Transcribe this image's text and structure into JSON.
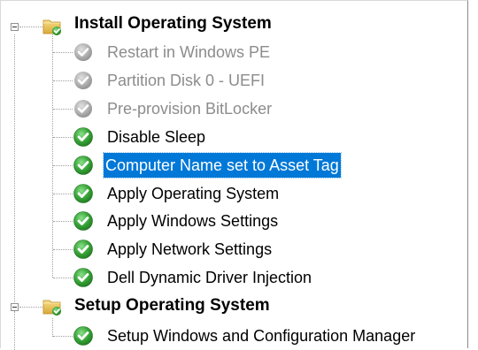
{
  "tree": {
    "groups": [
      {
        "label": "Install Operating System",
        "expanded": true,
        "icon": "folder-check-icon",
        "items": [
          {
            "label": "Restart in Windows PE",
            "state": "disabled",
            "icon": "gray-check-icon"
          },
          {
            "label": "Partition Disk 0 - UEFI",
            "state": "disabled",
            "icon": "gray-check-icon"
          },
          {
            "label": "Pre-provision BitLocker",
            "state": "disabled",
            "icon": "gray-check-icon"
          },
          {
            "label": "Disable Sleep",
            "state": "enabled",
            "icon": "green-check-icon"
          },
          {
            "label": "Computer Name set to Asset Tag",
            "state": "selected",
            "icon": "green-check-icon"
          },
          {
            "label": "Apply Operating System",
            "state": "enabled",
            "icon": "green-check-icon"
          },
          {
            "label": "Apply Windows Settings",
            "state": "enabled",
            "icon": "green-check-icon"
          },
          {
            "label": "Apply Network Settings",
            "state": "enabled",
            "icon": "green-check-icon"
          },
          {
            "label": "Dell Dynamic Driver Injection",
            "state": "enabled",
            "icon": "green-check-icon"
          }
        ]
      },
      {
        "label": "Setup Operating System",
        "expanded": true,
        "icon": "folder-check-icon",
        "items": [
          {
            "label": "Setup Windows and Configuration Manager",
            "state": "enabled",
            "icon": "green-check-icon"
          }
        ]
      }
    ]
  },
  "colors": {
    "selection": "#0078d7",
    "check_green": "#3aa63a",
    "check_gray": "#a6a6a6",
    "folder": "#e8c35a",
    "disabled_text": "#8c8c8c"
  }
}
